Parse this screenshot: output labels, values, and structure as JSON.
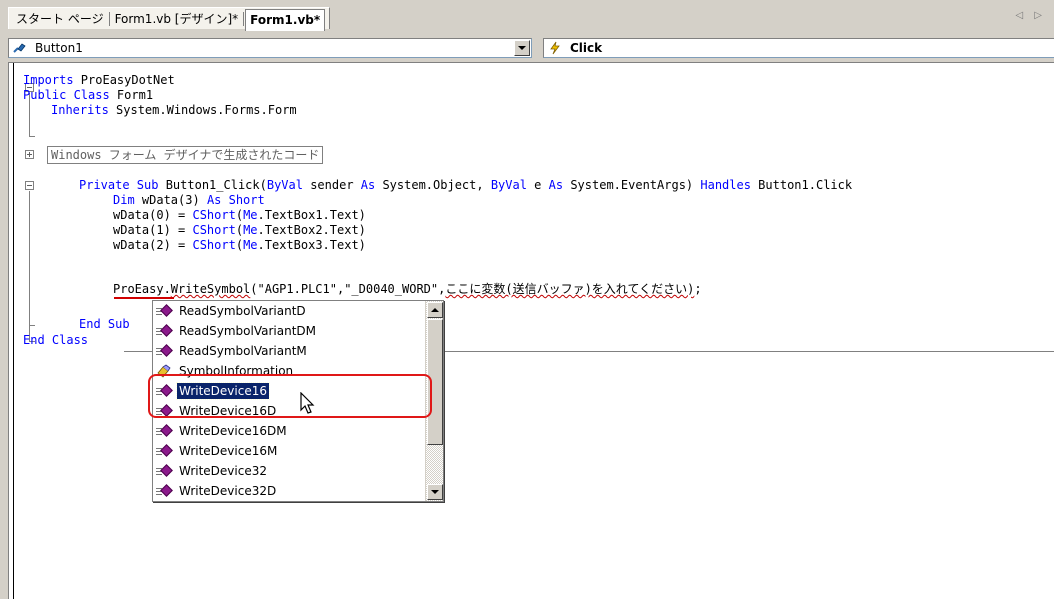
{
  "tabs": [
    {
      "label": "スタート ページ",
      "active": false
    },
    {
      "label": "Form1.vb [デザイン]*",
      "active": false
    },
    {
      "label": "Form1.vb*",
      "active": true
    }
  ],
  "tab_nav": "◁ ▷",
  "class_dropdown": {
    "value": "Button1"
  },
  "method_dropdown": {
    "value": "Click"
  },
  "code": {
    "line1_kw": "Imports",
    "line1_rest": " ProEasyDotNet",
    "line2_kw": "Public Class",
    "line2_rest": " Form1",
    "line3_kw": "Inherits",
    "line3_rest": " System.Windows.Forms.Form",
    "region": "Windows フォーム デザイナで生成されたコード",
    "sub_kw1": "Private Sub",
    "sub_name": " Button1_Click(",
    "sub_byval1": "ByVal",
    "sub_p1": " sender ",
    "sub_as1": "As",
    "sub_t1": " System.Object, ",
    "sub_byval2": "ByVal",
    "sub_p2": " e ",
    "sub_as2": "As",
    "sub_t2": " System.EventArgs) ",
    "sub_handles": "Handles",
    "sub_event": " Button1.Click",
    "dim_kw": "Dim",
    "dim_mid": " wData(3) ",
    "dim_as": "As Short",
    "w0_a": "wData(0) = ",
    "w0_fn": "CShort",
    "w0_b": "(",
    "w0_me": "Me",
    "w0_c": ".TextBox1.Text)",
    "w1_a": "wData(1) = ",
    "w1_fn": "CShort",
    "w1_b": "(",
    "w1_me": "Me",
    "w1_c": ".TextBox2.Text)",
    "w2_a": "wData(2) = ",
    "w2_fn": "CShort",
    "w2_b": "(",
    "w2_me": "Me",
    "w2_c": ".TextBox3.Text)",
    "pe_obj": "ProEasy.",
    "pe_method": "WriteSymbol",
    "pe_args": "(\"AGP1.PLC1\",\"_D0040_WORD\",",
    "pe_placeholder": "ここに変数(送信バッファ)を入れてください)",
    "pe_end": ";",
    "endsub": "End Sub",
    "endclass": "End Class"
  },
  "intellisense": {
    "items": [
      {
        "label": "ReadSymbolVariantD",
        "icon": "method-icon",
        "selected": false
      },
      {
        "label": "ReadSymbolVariantDM",
        "icon": "method-icon",
        "selected": false
      },
      {
        "label": "ReadSymbolVariantM",
        "icon": "method-icon",
        "selected": false
      },
      {
        "label": "SymbolInformation",
        "icon": "property-icon",
        "selected": false
      },
      {
        "label": "WriteDevice16",
        "icon": "method-icon",
        "selected": true
      },
      {
        "label": "WriteDevice16D",
        "icon": "method-icon",
        "selected": false
      },
      {
        "label": "WriteDevice16DM",
        "icon": "method-icon",
        "selected": false
      },
      {
        "label": "WriteDevice16M",
        "icon": "method-icon",
        "selected": false
      },
      {
        "label": "WriteDevice32",
        "icon": "method-icon",
        "selected": false
      },
      {
        "label": "WriteDevice32D",
        "icon": "method-icon",
        "selected": false
      }
    ]
  },
  "colors": {
    "keyword": "#0000ff",
    "selection": "#0a246a",
    "highlight_ring": "#e01818",
    "method_gem": "#8b1a8b"
  }
}
